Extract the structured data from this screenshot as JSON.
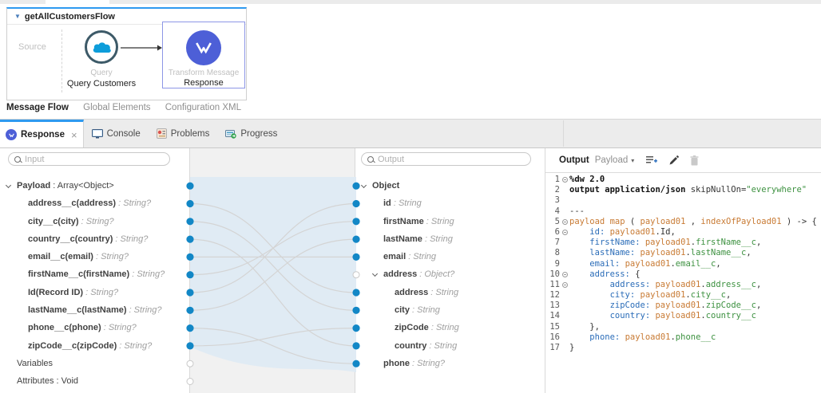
{
  "flow": {
    "title": "getAllCustomersFlow",
    "source_label": "Source",
    "query_node": {
      "type_label": "Query",
      "name": "Query Customers"
    },
    "transform_node": {
      "type_label": "Transform Message",
      "name": "Response"
    },
    "bottom_tabs": [
      "Message Flow",
      "Global Elements",
      "Configuration XML"
    ]
  },
  "editor_tabs": {
    "response": "Response",
    "console": "Console",
    "problems": "Problems",
    "progress": "Progress"
  },
  "input_panel": {
    "placeholder": "Input",
    "rows": [
      {
        "name": "Payload",
        "type": "Array<Object>",
        "typeStyle": "plain",
        "indent": 0,
        "expand": true
      },
      {
        "name": "address__c(address)",
        "type": "String?",
        "indent": 1
      },
      {
        "name": "city__c(city)",
        "type": "String?",
        "indent": 1
      },
      {
        "name": "country__c(country)",
        "type": "String?",
        "indent": 1
      },
      {
        "name": "email__c(email)",
        "type": "String?",
        "indent": 1
      },
      {
        "name": "firstName__c(firstName)",
        "type": "String?",
        "indent": 1
      },
      {
        "name": "Id(Record ID)",
        "type": "String?",
        "indent": 1
      },
      {
        "name": "lastName__c(lastName)",
        "type": "String?",
        "indent": 1
      },
      {
        "name": "phone__c(phone)",
        "type": "String?",
        "indent": 1
      },
      {
        "name": "zipCode__c(zipCode)",
        "type": "String?",
        "indent": 1
      },
      {
        "name": "Variables",
        "indent": 0,
        "plainName": true
      },
      {
        "name": "Attributes",
        "type": "Void",
        "typeStyle": "plain",
        "indent": 0,
        "plainName": true
      }
    ]
  },
  "output_panel": {
    "placeholder": "Output",
    "rows": [
      {
        "name": "Object",
        "indent": 0,
        "expand": true
      },
      {
        "name": "id",
        "type": "String",
        "indent": 1
      },
      {
        "name": "firstName",
        "type": "String",
        "indent": 1
      },
      {
        "name": "lastName",
        "type": "String",
        "indent": 1
      },
      {
        "name": "email",
        "type": "String",
        "indent": 1
      },
      {
        "name": "address",
        "type": "Object?",
        "indent": 1,
        "expand": true
      },
      {
        "name": "address",
        "type": "String",
        "indent": 2
      },
      {
        "name": "city",
        "type": "String",
        "indent": 2
      },
      {
        "name": "zipCode",
        "type": "String",
        "indent": 2
      },
      {
        "name": "country",
        "type": "String",
        "indent": 2
      },
      {
        "name": "phone",
        "type": "String?",
        "indent": 1
      }
    ]
  },
  "mapping": {
    "left_dots": [
      "solid",
      "solid",
      "solid",
      "solid",
      "solid",
      "solid",
      "solid",
      "solid",
      "solid",
      "solid",
      "hollow",
      "hollow"
    ],
    "right_dots": [
      "solid",
      "solid",
      "solid",
      "solid",
      "solid",
      "hollow",
      "solid",
      "solid",
      "solid",
      "solid",
      "solid"
    ],
    "connections": [
      [
        1,
        6
      ],
      [
        2,
        7
      ],
      [
        3,
        9
      ],
      [
        4,
        4
      ],
      [
        5,
        2
      ],
      [
        6,
        1
      ],
      [
        7,
        3
      ],
      [
        8,
        10
      ],
      [
        9,
        8
      ]
    ]
  },
  "code_panel": {
    "title": "Output",
    "context": "Payload",
    "lines": [
      {
        "n": 1,
        "fold": true,
        "tokens": [
          [
            "b",
            "%dw 2.0"
          ]
        ]
      },
      {
        "n": 2,
        "fold": false,
        "tokens": [
          [
            "b",
            "output application/json"
          ],
          [
            "p",
            " skipNullOn="
          ],
          [
            "s",
            "\"everywhere\""
          ]
        ]
      },
      {
        "n": 3,
        "fold": false,
        "tokens": []
      },
      {
        "n": 4,
        "fold": false,
        "tokens": [
          [
            "p",
            "---"
          ]
        ]
      },
      {
        "n": 5,
        "fold": true,
        "tokens": [
          [
            "v",
            "payload"
          ],
          [
            "p",
            " "
          ],
          [
            "v",
            "map"
          ],
          [
            "p",
            " ( "
          ],
          [
            "v",
            "payload01"
          ],
          [
            "p",
            " , "
          ],
          [
            "v",
            "indexOfPayload01"
          ],
          [
            "p",
            " ) -> {"
          ]
        ]
      },
      {
        "n": 6,
        "fold": true,
        "tokens": [
          [
            "p",
            "    "
          ],
          [
            "k",
            "id:"
          ],
          [
            "p",
            " "
          ],
          [
            "v",
            "payload01"
          ],
          [
            "p",
            ".Id,"
          ]
        ]
      },
      {
        "n": 7,
        "fold": false,
        "tokens": [
          [
            "p",
            "    "
          ],
          [
            "k",
            "firstName:"
          ],
          [
            "p",
            " "
          ],
          [
            "v",
            "payload01"
          ],
          [
            "p",
            "."
          ],
          [
            "f",
            "firstName__c"
          ],
          [
            "p",
            ","
          ]
        ]
      },
      {
        "n": 8,
        "fold": false,
        "tokens": [
          [
            "p",
            "    "
          ],
          [
            "k",
            "lastName:"
          ],
          [
            "p",
            " "
          ],
          [
            "v",
            "payload01"
          ],
          [
            "p",
            "."
          ],
          [
            "f",
            "lastName__c"
          ],
          [
            "p",
            ","
          ]
        ]
      },
      {
        "n": 9,
        "fold": false,
        "tokens": [
          [
            "p",
            "    "
          ],
          [
            "k",
            "email:"
          ],
          [
            "p",
            " "
          ],
          [
            "v",
            "payload01"
          ],
          [
            "p",
            "."
          ],
          [
            "f",
            "email__c"
          ],
          [
            "p",
            ","
          ]
        ]
      },
      {
        "n": 10,
        "fold": true,
        "tokens": [
          [
            "p",
            "    "
          ],
          [
            "k",
            "address:"
          ],
          [
            "p",
            " {"
          ]
        ]
      },
      {
        "n": 11,
        "fold": true,
        "tokens": [
          [
            "p",
            "        "
          ],
          [
            "k",
            "address:"
          ],
          [
            "p",
            " "
          ],
          [
            "v",
            "payload01"
          ],
          [
            "p",
            "."
          ],
          [
            "f",
            "address__c"
          ],
          [
            "p",
            ","
          ]
        ]
      },
      {
        "n": 12,
        "fold": false,
        "tokens": [
          [
            "p",
            "        "
          ],
          [
            "k",
            "city:"
          ],
          [
            "p",
            " "
          ],
          [
            "v",
            "payload01"
          ],
          [
            "p",
            "."
          ],
          [
            "f",
            "city__c"
          ],
          [
            "p",
            ","
          ]
        ]
      },
      {
        "n": 13,
        "fold": false,
        "tokens": [
          [
            "p",
            "        "
          ],
          [
            "k",
            "zipCode:"
          ],
          [
            "p",
            " "
          ],
          [
            "v",
            "payload01"
          ],
          [
            "p",
            "."
          ],
          [
            "f",
            "zipCode__c"
          ],
          [
            "p",
            ","
          ]
        ]
      },
      {
        "n": 14,
        "fold": false,
        "tokens": [
          [
            "p",
            "        "
          ],
          [
            "k",
            "country:"
          ],
          [
            "p",
            " "
          ],
          [
            "v",
            "payload01"
          ],
          [
            "p",
            "."
          ],
          [
            "f",
            "country__c"
          ]
        ]
      },
      {
        "n": 15,
        "fold": false,
        "tokens": [
          [
            "p",
            "    },"
          ]
        ]
      },
      {
        "n": 16,
        "fold": false,
        "tokens": [
          [
            "p",
            "    "
          ],
          [
            "k",
            "phone:"
          ],
          [
            "p",
            " "
          ],
          [
            "v",
            "payload01"
          ],
          [
            "p",
            "."
          ],
          [
            "f",
            "phone__c"
          ]
        ]
      },
      {
        "n": 17,
        "fold": false,
        "tokens": [
          [
            "p",
            "}"
          ]
        ]
      }
    ]
  },
  "colors": {
    "accent_blue": "#2E9AF0",
    "dot_blue": "#1287C6",
    "dataweave_purple": "#4D5FD7",
    "salesforce_blue": "#0D9DDA",
    "band_blue": "#E0EBF4",
    "curve_gray": "#D4D4D4",
    "key_blue": "#2A6CB8",
    "var_orange": "#C87A33",
    "field_green": "#3D9140"
  }
}
